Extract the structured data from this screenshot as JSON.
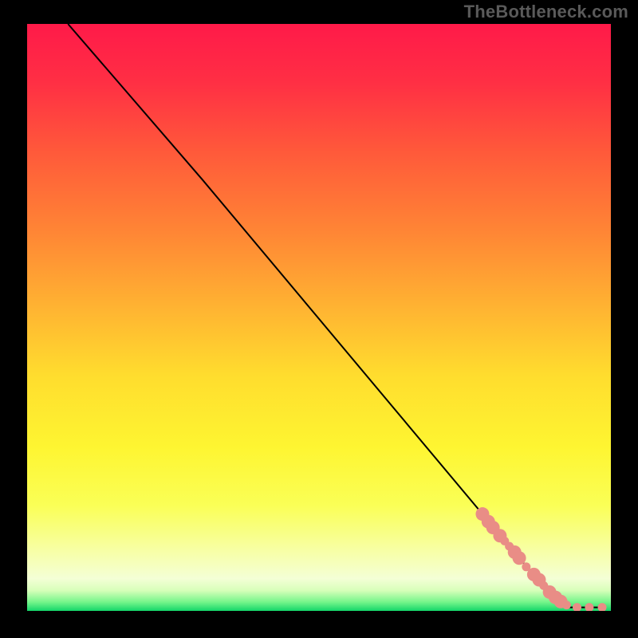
{
  "watermark": "TheBottleneck.com",
  "gradient": {
    "stops": [
      {
        "offset": 0.0,
        "color": "#ff1a49"
      },
      {
        "offset": 0.1,
        "color": "#ff2f44"
      },
      {
        "offset": 0.22,
        "color": "#ff5a3a"
      },
      {
        "offset": 0.35,
        "color": "#ff8435"
      },
      {
        "offset": 0.48,
        "color": "#ffb232"
      },
      {
        "offset": 0.6,
        "color": "#ffdd2e"
      },
      {
        "offset": 0.72,
        "color": "#fef531"
      },
      {
        "offset": 0.82,
        "color": "#faff56"
      },
      {
        "offset": 0.9,
        "color": "#f7ffa8"
      },
      {
        "offset": 0.945,
        "color": "#f4ffd6"
      },
      {
        "offset": 0.965,
        "color": "#d8ffba"
      },
      {
        "offset": 0.985,
        "color": "#75f58a"
      },
      {
        "offset": 1.0,
        "color": "#14d66a"
      }
    ]
  },
  "chart_data": {
    "type": "line",
    "title": "",
    "xlabel": "",
    "ylabel": "",
    "xlim": [
      0,
      100
    ],
    "ylim": [
      0,
      100
    ],
    "series": [
      {
        "name": "curve",
        "stroke": "#000000",
        "stroke_width": 2,
        "x": [
          7.0,
          30.0,
          86.0,
          93.0,
          98.5
        ],
        "values": [
          100.0,
          73.5,
          7.0,
          0.6,
          0.6
        ]
      }
    ],
    "markers": {
      "color": "#e98d86",
      "radius_small": 5.5,
      "radius_large": 8.5,
      "points": [
        {
          "x": 78.0,
          "y": 16.5,
          "r": "large"
        },
        {
          "x": 79.0,
          "y": 15.2,
          "r": "large"
        },
        {
          "x": 79.8,
          "y": 14.2,
          "r": "large"
        },
        {
          "x": 81.0,
          "y": 12.8,
          "r": "large"
        },
        {
          "x": 81.8,
          "y": 11.9,
          "r": "small"
        },
        {
          "x": 82.6,
          "y": 11.0,
          "r": "small"
        },
        {
          "x": 83.5,
          "y": 10.0,
          "r": "large"
        },
        {
          "x": 84.3,
          "y": 9.0,
          "r": "large"
        },
        {
          "x": 85.5,
          "y": 7.5,
          "r": "small"
        },
        {
          "x": 86.8,
          "y": 6.2,
          "r": "large"
        },
        {
          "x": 87.7,
          "y": 5.3,
          "r": "large"
        },
        {
          "x": 88.5,
          "y": 4.3,
          "r": "small"
        },
        {
          "x": 89.5,
          "y": 3.2,
          "r": "large"
        },
        {
          "x": 90.5,
          "y": 2.3,
          "r": "large"
        },
        {
          "x": 91.4,
          "y": 1.6,
          "r": "large"
        },
        {
          "x": 92.4,
          "y": 1.0,
          "r": "small"
        },
        {
          "x": 94.2,
          "y": 0.6,
          "r": "small"
        },
        {
          "x": 96.3,
          "y": 0.6,
          "r": "small"
        },
        {
          "x": 98.5,
          "y": 0.6,
          "r": "small"
        }
      ]
    }
  }
}
